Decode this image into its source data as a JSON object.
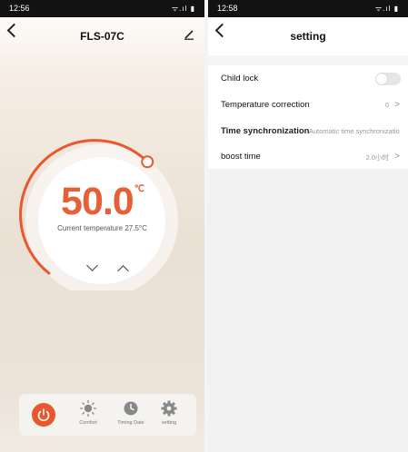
{
  "left_screen": {
    "status_time": "12:56",
    "status_icons": "ᯤ.ıl ▮",
    "title": "FLS-07C",
    "set_temperature": "50.0",
    "temperature_unit": "℃",
    "current_temperature": "Current temperature 27.5°C",
    "dial_level_fraction": 0.83,
    "bottom_nav": [
      {
        "label": "",
        "icon": "power-icon"
      },
      {
        "label": "Comfort",
        "icon": "sun-icon"
      },
      {
        "label": "Timing Date",
        "icon": "clock-icon"
      },
      {
        "label": "setting",
        "icon": "gear-icon"
      }
    ]
  },
  "right_screen": {
    "status_time": "12:58",
    "status_icons": "ᯤ.ıl ▮",
    "title": "setting",
    "child_lock": {
      "label": "Child lock",
      "enabled": false
    },
    "temperature_correction": {
      "label": "Temperature correction",
      "value": "0"
    },
    "time_sync": {
      "label": "Time synchronization",
      "value": "Automatic time synchronizatio"
    },
    "boost_time": {
      "label": "boost time",
      "value": "2.0小时"
    }
  },
  "colors": {
    "accent": "#e8582e",
    "toggle_off": "#e5e5e5"
  }
}
